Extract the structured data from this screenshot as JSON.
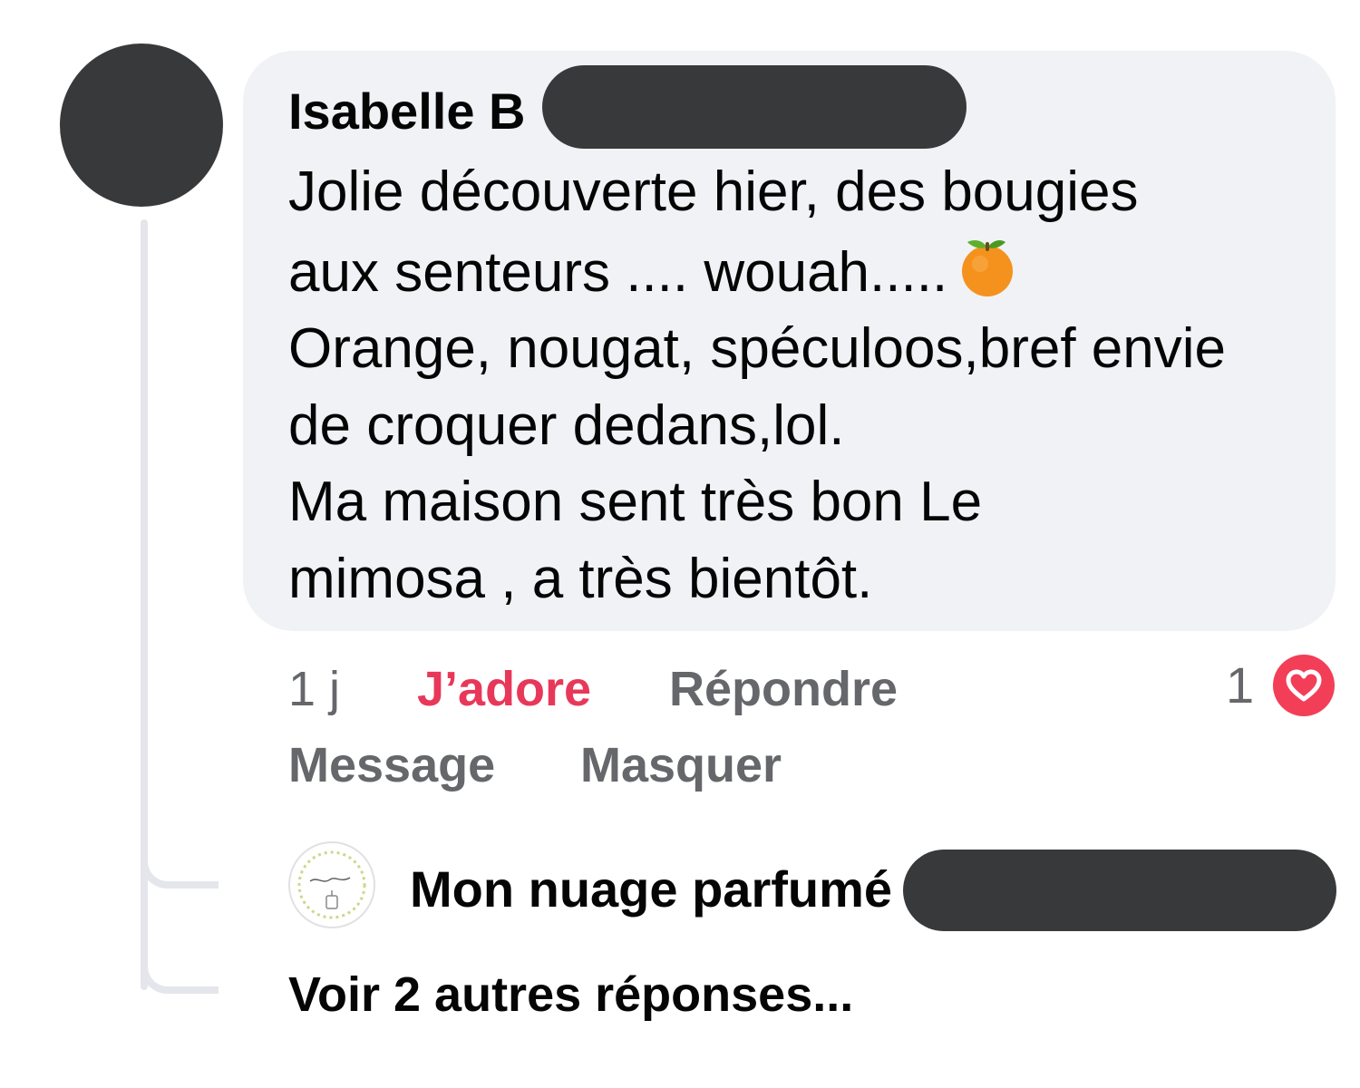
{
  "comment": {
    "author_name": "Isabelle B",
    "text_lines": [
      "Jolie découverte hier, des bougies",
      "aux senteurs .... wouah.....",
      "Orange, nougat, spéculoos,bref envie",
      "de croquer dedans,lol.",
      "Ma maison sent très bon Le",
      "mimosa , a très bientôt."
    ],
    "emoji": "orange-icon"
  },
  "actions": {
    "time_ago": "1 j",
    "love_label": "J’adore",
    "reply_label": "Répondre",
    "message_label": "Message",
    "hide_label": "Masquer"
  },
  "reactions": {
    "count": "1",
    "type": "heart-icon",
    "color": "#f33e58"
  },
  "reply": {
    "author_name": "Mon nuage parfumé",
    "avatar_icon": "brand-logo-icon"
  },
  "more_replies_label": "Voir 2 autres réponses...",
  "colors": {
    "bubble_bg": "#f0f2f5",
    "love_accent": "#e8385a",
    "secondary_text": "#65676b"
  }
}
